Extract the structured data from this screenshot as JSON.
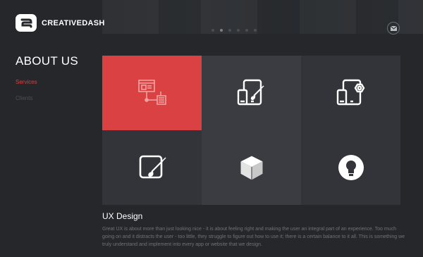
{
  "brand": {
    "name": "CREATIVEDASH"
  },
  "header": {
    "slider_dots": 6,
    "active_dot": 1,
    "contact_icon": "envelope-icon"
  },
  "sidebar": {
    "title": "ABOUT US",
    "items": [
      {
        "label": "Services",
        "active": true
      },
      {
        "label": "Clients",
        "active": false
      }
    ]
  },
  "services": {
    "tiles": [
      {
        "icon": "ux-wireframe-icon",
        "active": true
      },
      {
        "icon": "responsive-design-icon",
        "active": false
      },
      {
        "icon": "app-development-icon",
        "active": false
      },
      {
        "icon": "graphic-design-icon",
        "active": false
      },
      {
        "icon": "3d-cube-icon",
        "active": false
      },
      {
        "icon": "lightbulb-icon",
        "active": false
      }
    ],
    "selected": {
      "title": "UX Design",
      "description": "Great UX is about more than just looking nice - it is about feeling right and making the user an integral part of an experience. Too much going on and it distracts the user - too little, they struggle to figure out how to use it; there is a certain balance to it all. This is something we truly understand and implement into every app or website that we design."
    }
  },
  "colors": {
    "accent": "#d94142",
    "background": "#25272b",
    "tile_light": "#3a3c41",
    "tile_dark": "#323439"
  }
}
